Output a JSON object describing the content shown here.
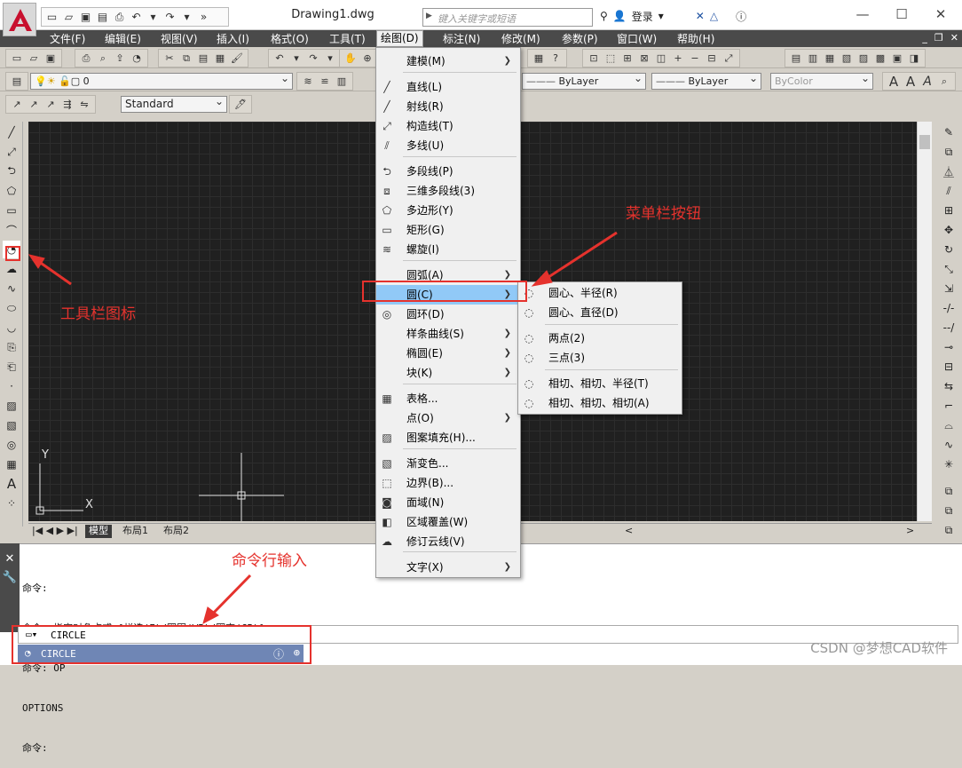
{
  "app": {
    "title": "Drawing1.dwg",
    "search_placeholder": "键入关键字或短语",
    "login_label": "登录"
  },
  "menubar": [
    "文件(F)",
    "编辑(E)",
    "视图(V)",
    "插入(I)",
    "格式(O)",
    "工具(T)",
    "绘图(D)",
    "标注(N)",
    "修改(M)",
    "参数(P)",
    "窗口(W)",
    "帮助(H)"
  ],
  "layer": {
    "current": "0"
  },
  "style": {
    "text_style": "Standard"
  },
  "properties": {
    "color": "ByLayer",
    "linetype": "ByLayer",
    "plotstyle": "ByColor"
  },
  "draw_menu": [
    {
      "label": "建模(M)",
      "icon": "",
      "submenu": true
    },
    {
      "label": "直线(L)",
      "icon": "line-icon",
      "submenu": false
    },
    {
      "label": "射线(R)",
      "icon": "ray-icon",
      "submenu": false
    },
    {
      "label": "构造线(T)",
      "icon": "xline-icon",
      "submenu": false
    },
    {
      "label": "多线(U)",
      "icon": "mline-icon",
      "submenu": false
    },
    {
      "label": "多段线(P)",
      "icon": "polyline-icon",
      "submenu": false
    },
    {
      "label": "三维多段线(3)",
      "icon": "3dpoly-icon",
      "submenu": false
    },
    {
      "label": "多边形(Y)",
      "icon": "polygon-icon",
      "submenu": false
    },
    {
      "label": "矩形(G)",
      "icon": "rectangle-icon",
      "submenu": false
    },
    {
      "label": "螺旋(I)",
      "icon": "helix-icon",
      "submenu": false
    },
    {
      "label": "圆弧(A)",
      "icon": "",
      "submenu": true
    },
    {
      "label": "圆(C)",
      "icon": "",
      "submenu": true,
      "highlight": true
    },
    {
      "label": "圆环(D)",
      "icon": "donut-icon",
      "submenu": false
    },
    {
      "label": "样条曲线(S)",
      "icon": "",
      "submenu": true
    },
    {
      "label": "椭圆(E)",
      "icon": "",
      "submenu": true
    },
    {
      "label": "块(K)",
      "icon": "",
      "submenu": true
    },
    {
      "label": "表格...",
      "icon": "table-icon",
      "submenu": false
    },
    {
      "label": "点(O)",
      "icon": "",
      "submenu": true
    },
    {
      "label": "图案填充(H)...",
      "icon": "hatch-icon",
      "submenu": false
    },
    {
      "label": "渐变色...",
      "icon": "gradient-icon",
      "submenu": false
    },
    {
      "label": "边界(B)...",
      "icon": "boundary-icon",
      "submenu": false
    },
    {
      "label": "面域(N)",
      "icon": "region-icon",
      "submenu": false
    },
    {
      "label": "区域覆盖(W)",
      "icon": "wipeout-icon",
      "submenu": false
    },
    {
      "label": "修订云线(V)",
      "icon": "revcloud-icon",
      "submenu": false
    },
    {
      "label": "文字(X)",
      "icon": "",
      "submenu": true
    }
  ],
  "circle_submenu": [
    "圆心、半径(R)",
    "圆心、直径(D)",
    "两点(2)",
    "三点(3)",
    "相切、相切、半径(T)",
    "相切、相切、相切(A)"
  ],
  "layout_tabs": [
    "模型",
    "布局1",
    "布局2"
  ],
  "command_history": [
    "命令:",
    "命令: 指定对角点或 [栏选(F)/圈围(WP)/圈交(CP)]:",
    "命令: OP",
    "OPTIONS",
    "命令:"
  ],
  "command_input": "CIRCLE",
  "command_suggestion": "CIRCLE",
  "annotations": {
    "menu_button": "菜单栏按钮",
    "toolbar_icon": "工具栏图标",
    "command_line": "命令行输入"
  },
  "watermark": "CSDN @梦想CAD软件",
  "ucs": {
    "y_label": "Y",
    "x_label": "X"
  }
}
